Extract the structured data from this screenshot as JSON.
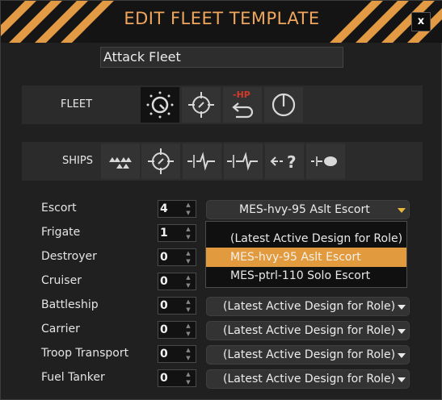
{
  "window": {
    "title": "EDIT FLEET TEMPLATE",
    "close_label": "x",
    "accent_color": "#f0a65c"
  },
  "template_name": "Attack Fleet",
  "fleet_strip": {
    "label": "FLEET",
    "buttons": [
      {
        "icon": "aggression-dial-icon",
        "active": true
      },
      {
        "icon": "target-crosshair-icon",
        "active": false
      },
      {
        "icon": "retreat-hp-icon",
        "badge": "-HP",
        "active": false
      },
      {
        "icon": "power-icon",
        "active": false
      }
    ]
  },
  "ships_strip": {
    "label": "SHIPS",
    "buttons": [
      {
        "icon": "formation-icon"
      },
      {
        "icon": "engage-target-icon"
      },
      {
        "icon": "short-range-signal-icon"
      },
      {
        "icon": "long-range-signal-icon"
      },
      {
        "icon": "unknown-target-icon",
        "badge": "?"
      },
      {
        "icon": "planet-target-icon"
      }
    ]
  },
  "roles": [
    {
      "label": "Escort",
      "quantity": "4",
      "design": "MES-hvy-95  Aslt Escort",
      "open": true
    },
    {
      "label": "Frigate",
      "quantity": "1",
      "design": ""
    },
    {
      "label": "Destroyer",
      "quantity": "0",
      "design": ""
    },
    {
      "label": "Cruiser",
      "quantity": "0",
      "design": ""
    },
    {
      "label": "Battleship",
      "quantity": "0",
      "design": "(Latest Active Design for Role)"
    },
    {
      "label": "Carrier",
      "quantity": "0",
      "design": "(Latest Active Design for Role)"
    },
    {
      "label": "Troop Transport",
      "quantity": "0",
      "design": "(Latest Active Design for Role)"
    },
    {
      "label": "Fuel Tanker",
      "quantity": "0",
      "design": "(Latest Active Design for Role)"
    }
  ],
  "dropdown": {
    "options": [
      {
        "label": "(Latest Active Design for Role)",
        "selected": false
      },
      {
        "label": "MES-hvy-95  Aslt Escort",
        "selected": true
      },
      {
        "label": "MES-ptrl-110  Solo Escort",
        "selected": false
      }
    ]
  }
}
